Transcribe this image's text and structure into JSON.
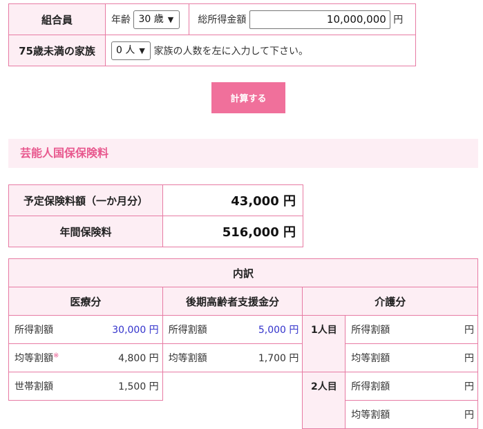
{
  "form": {
    "member_label": "組合員",
    "age_label": "年齢",
    "age_value": "30 歳",
    "income_label": "総所得金額",
    "income_value": "10,000,000",
    "income_unit": "円",
    "family_label": "75歳未満の家族",
    "family_value": "0 人",
    "family_hint": "家族の人数を左に入力して下さい。"
  },
  "calculate_button": "計算する",
  "section_title": "芸能人国保保険料",
  "results": [
    {
      "label": "予定保険料額（一か月分）",
      "value": "43,000 円"
    },
    {
      "label": "年間保険料",
      "value": "516,000 円"
    }
  ],
  "breakdown": {
    "title": "内訳",
    "medical": {
      "title": "医療分",
      "rows": [
        {
          "label": "所得割額",
          "value": "30,000 円"
        },
        {
          "label": "均等割額",
          "mark": "※",
          "value": "4,800 円"
        },
        {
          "label": "世帯割額",
          "value": "1,500 円"
        }
      ]
    },
    "support": {
      "title": "後期高齢者支援金分",
      "rows": [
        {
          "label": "所得割額",
          "value": "5,000 円"
        },
        {
          "label": "均等割額",
          "value": "1,700 円"
        }
      ]
    },
    "care": {
      "title": "介護分",
      "persons": [
        {
          "label": "1人目",
          "rows": [
            {
              "label": "所得割額",
              "value": "円"
            },
            {
              "label": "均等割額",
              "value": "円"
            }
          ]
        },
        {
          "label": "2人目",
          "rows": [
            {
              "label": "所得割額",
              "value": "円"
            },
            {
              "label": "均等割額",
              "value": "円"
            }
          ]
        }
      ]
    }
  },
  "colors": {
    "accent": "#f0709b",
    "border": "#e77aa3",
    "header_bg": "#fdeef4",
    "section_text": "#e8588e",
    "value_blue": "#3333cc"
  }
}
